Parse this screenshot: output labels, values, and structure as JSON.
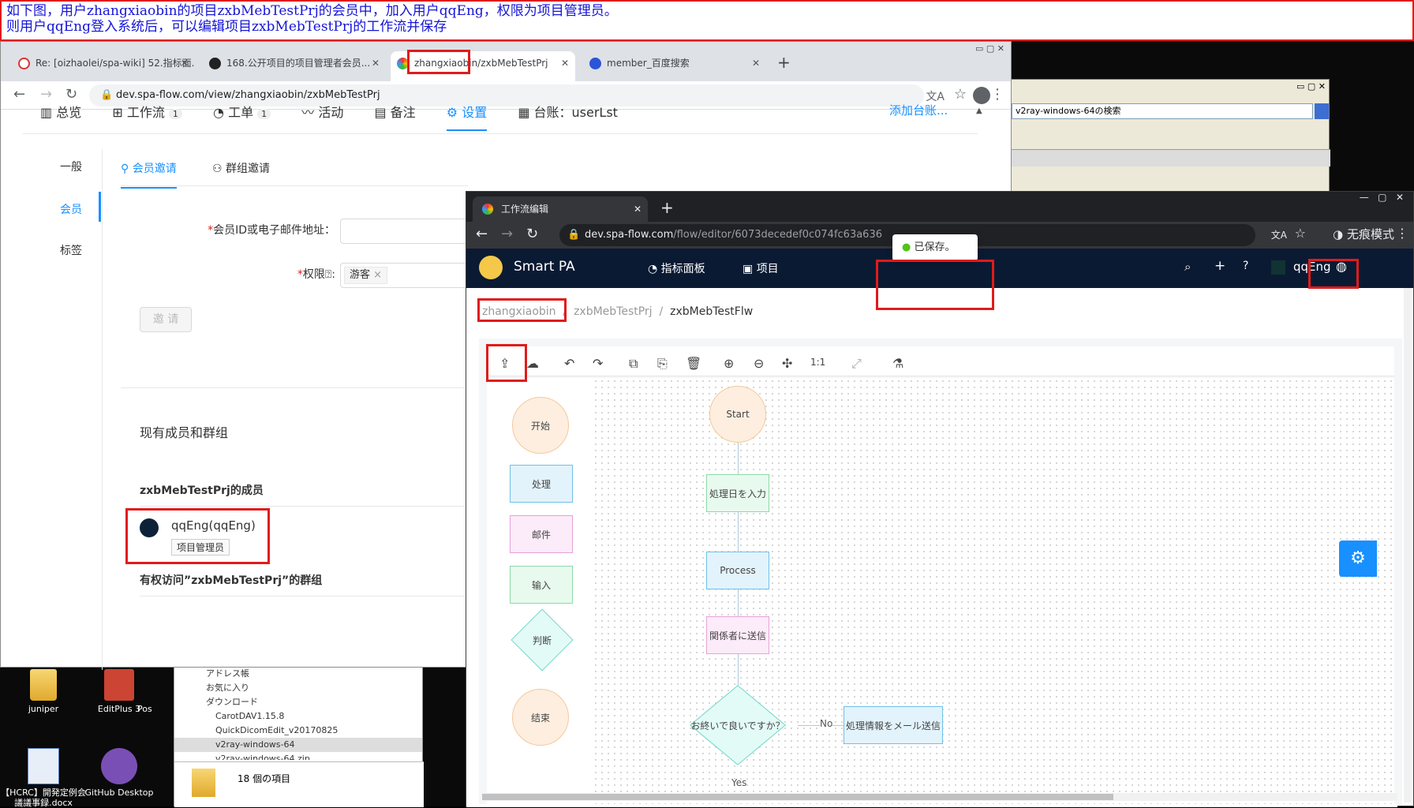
{
  "annotation": {
    "line1": "如下图，用户zhangxiaobin的项目zxbMebTestPrj的会员中，加入用户qqEng，权限为项目管理员。",
    "line2": "则用户qqEng登入系统后，可以编辑项目zxbMebTestPrj的工作流并保存"
  },
  "desktop": {
    "icons": [
      {
        "label": "juniper"
      },
      {
        "label": "EditPlus 3"
      },
      {
        "label": "Pos"
      },
      {
        "label": "【HCRC】開発定例会議議事録.docx"
      },
      {
        "label": "GitHub Desktop"
      }
    ],
    "explorer": {
      "items": [
        "アドレス帳",
        "お気に入り",
        "ダウンロード",
        "CarotDAV1.15.8",
        "QuickDicomEdit_v20170825",
        "v2ray-windows-64",
        "v2ray-windows-64.zip"
      ],
      "status": "18 個の項目"
    },
    "xp_window": {
      "search_text": "v2ray-windows-64の検索"
    }
  },
  "browser1": {
    "tabs": [
      {
        "label": "Re: [oizhaolei/spa-wiki] 52.指标面..."
      },
      {
        "label": "168.公开项目的项目管理者会员..."
      },
      {
        "label": "zhangxiaobin/zxbMebTestPrj"
      },
      {
        "label": "member_百度搜索"
      }
    ],
    "url": "dev.spa-flow.com/view/zhangxiaobin/zxbMebTestPrj",
    "nav": {
      "overview": "总览",
      "workflow": "工作流",
      "workflow_count": "1",
      "ticket": "工单",
      "ticket_count": "1",
      "activity": "活动",
      "memo": "备注",
      "settings": "设置",
      "ledger": "台账：userLst",
      "add_ledger": "添加台账..."
    },
    "sidebar": [
      "一般",
      "会员",
      "标签"
    ],
    "subtabs": {
      "member_invite": "会员邀请",
      "group_invite": "群组邀请"
    },
    "form": {
      "id_label": "会员ID或电子邮件地址：",
      "perm_label": "权限",
      "perm_value": "游客",
      "invite_button": "邀 请"
    },
    "existing_title": "现有成员和群组",
    "members_title": "zxbMebTestPrj的成员",
    "member": {
      "name": "qqEng(qqEng)",
      "role": "项目管理员"
    },
    "groups_title": "有权访问”zxbMebTestPrj”的群组"
  },
  "browser2": {
    "tab": "工作流编辑",
    "url_host": "dev.spa-flow.com",
    "url_path": "/flow/editor/6073decedef0c074fc63a636",
    "incognito": "无痕模式",
    "app": {
      "name": "Smart PA",
      "dashboard": "指标面板",
      "project": "项目",
      "user": "qqEng"
    },
    "toast": "已保存。",
    "breadcrumb": [
      "zhangxiaobin",
      "zxbMebTestPrj",
      "zxbMebTestFlw"
    ],
    "palette": [
      "开始",
      "处理",
      "邮件",
      "输入",
      "判断",
      "结束"
    ],
    "flow": {
      "start": "Start",
      "n1": "処理日を入力",
      "n2": "Process",
      "n3": "関係者に送信",
      "decision": "お終いで良いですか？",
      "no": "No",
      "yes": "Yes",
      "n4": "処理情報をメール送信"
    }
  },
  "colors": {
    "accent": "#1890ff",
    "red": "#e01b1b",
    "navy": "#0b1a33"
  }
}
